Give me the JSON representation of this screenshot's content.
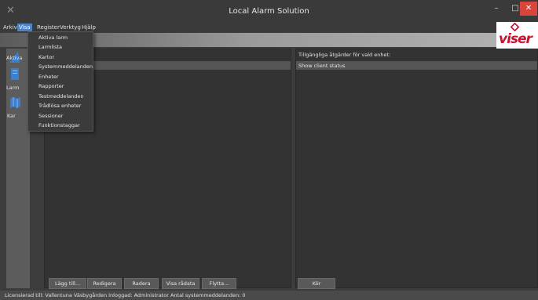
{
  "window": {
    "title": "Local Alarm Solution",
    "min_glyph": "–",
    "max_glyph": "□",
    "close_glyph": "✕"
  },
  "menubar": {
    "items": [
      "Arkiv",
      "Visa",
      "Register",
      "Verktyg",
      "Hjälp"
    ],
    "active_index": 1
  },
  "visa_menu": {
    "items": [
      "Aktiva larm",
      "Larmlista",
      "Kartor",
      "Systemmeddelanden",
      "Enheter",
      "Rapporter",
      "Testmeddelanden",
      "Trådlösa enheter",
      "Sessioner",
      "Funktionstaggar"
    ]
  },
  "sidebar": {
    "labels": [
      "Aktiva",
      "Larm",
      "Kar"
    ]
  },
  "right_panel": {
    "header": "Tillgängliga åtgärder för vald enhet:",
    "actions": [
      "Show client status"
    ]
  },
  "buttons": {
    "add": "Lägg till...",
    "edit": "Redigera",
    "delete": "Radera",
    "show_raw": "Visa rådata",
    "move": "Flytta...",
    "run": "Kör"
  },
  "status_bar": {
    "text": "Licensierad till: Vallentuna Väsbygården  Inloggad: Administrator  Antal systemmeddelanden: 0"
  },
  "logo": {
    "text": "viser",
    "color": "#c8112e"
  },
  "colors": {
    "accent": "#4d83c7",
    "close": "#d9443b"
  }
}
